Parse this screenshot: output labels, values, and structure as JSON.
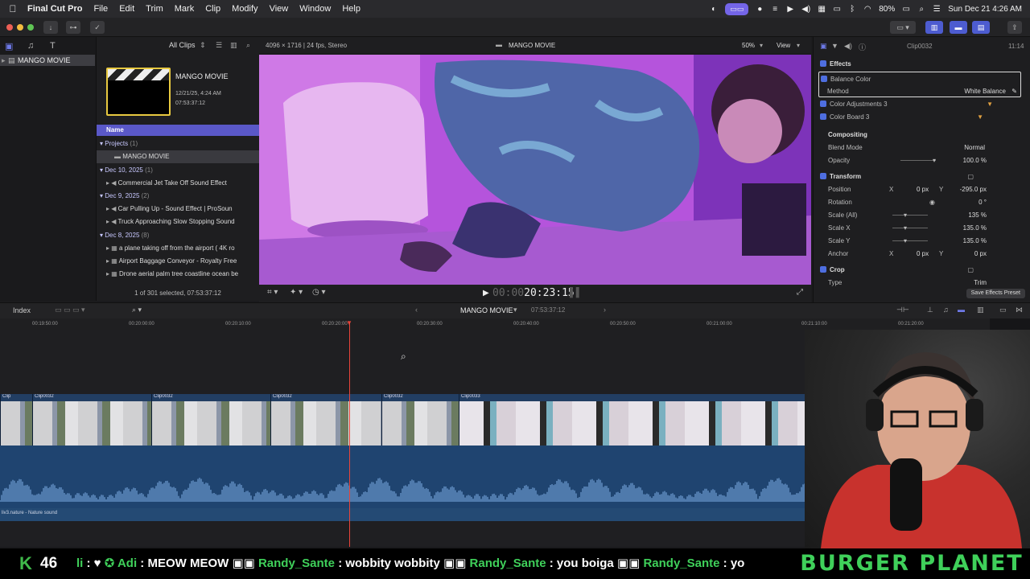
{
  "menubar": {
    "app": "Final Cut Pro",
    "items": [
      "File",
      "Edit",
      "Trim",
      "Mark",
      "Clip",
      "Modify",
      "View",
      "Window",
      "Help"
    ],
    "battery": "80%",
    "datetime": "Sun Dec 21  4:26 AM"
  },
  "library": {
    "name": "MANGO MOVIE"
  },
  "browser": {
    "filter": "All Clips",
    "project_thumb_title": "MANGO MOVIE",
    "project_thumb_date": "12/21/25, 4:24 AM",
    "project_thumb_duration": "07:53:37:12",
    "column_name": "Name",
    "groups": [
      {
        "label": "Projects",
        "count": "(1)",
        "items": [
          "MANGO MOVIE"
        ]
      },
      {
        "label": "Dec 10, 2025",
        "count": "(1)",
        "items": [
          "Commercial Jet Take Off Sound Effect"
        ]
      },
      {
        "label": "Dec 9, 2025",
        "count": "(2)",
        "items": [
          "Car Pulling Up - Sound Effect  |  ProSoun",
          "Truck Approaching Slow Stopping Sound"
        ]
      },
      {
        "label": "Dec 8, 2025",
        "count": "(8)",
        "items": [
          "a plane taking off from the airport ( 4K ro",
          "Airport Baggage Conveyor - Royalty Free",
          "Drone aerial palm tree coastline ocean be"
        ]
      }
    ],
    "selection_info": "1 of 301 selected, 07:53:37:12"
  },
  "viewer": {
    "format": "4096 × 1716 | 24 fps, Stereo",
    "title": "MANGO MOVIE",
    "zoom": "50%",
    "view_menu": "View",
    "timecode_prefix": "00:00",
    "timecode": "20:23:15"
  },
  "inspector": {
    "clip_name": "Clip0032",
    "duration": "11:14",
    "effects_label": "Effects",
    "balance_color": "Balance Color",
    "method_label": "Method",
    "method_value": "White Balance",
    "color_adjustments": "Color Adjustments 3",
    "color_board": "Color Board 3",
    "compositing": "Compositing",
    "blend_mode_label": "Blend Mode",
    "blend_mode_value": "Normal",
    "opacity_label": "Opacity",
    "opacity_value": "100.0 %",
    "opacity_level": 1.0,
    "transform": "Transform",
    "position_label": "Position",
    "position_x": "0 px",
    "position_y": "-295.0 px",
    "rotation_label": "Rotation",
    "rotation_value": "0 °",
    "scale_all_label": "Scale (All)",
    "scale_all_value": "135 %",
    "scale_x_label": "Scale X",
    "scale_x_value": "135.0 %",
    "scale_y_label": "Scale Y",
    "scale_y_value": "135.0 %",
    "anchor_label": "Anchor",
    "anchor_x": "0 px",
    "anchor_y": "0 px",
    "crop": "Crop",
    "type_label": "Type",
    "type_value": "Trim",
    "save_preset": "Save Effects Preset",
    "x": "X",
    "y": "Y"
  },
  "timeline": {
    "index": "Index",
    "project": "MANGO MOVIE",
    "duration": "07:53:37:12",
    "ruler": [
      "00:19:50:00",
      "00:20:00:00",
      "00:20:10:00",
      "00:20:20:00",
      "00:20:30:00",
      "00:20:40:00",
      "00:20:50:00",
      "00:21:00:00",
      "00:21:10:00",
      "00:21:20:00"
    ],
    "clips": [
      "Clip",
      "Clip0032",
      "Clip0032",
      "Clip0032",
      "Clip0032",
      "Clip0033"
    ],
    "audio_clip": "liv3.nature - Nature sound"
  },
  "ticker": {
    "k_label": "K",
    "k_count": "46",
    "message": "li : ♥  ✪ Adi : MEOW  Randy_Sante : wobbity wobbity   Randy_Sante : you boiga   Randy_Sante : yo",
    "segments": [
      {
        "user": "li",
        "text": ": ♥"
      },
      {
        "user": "Adi",
        "text": ": MEOW MEOW"
      },
      {
        "user": "Randy_Sante",
        "text": ": wobbity wobbity"
      },
      {
        "user": "Randy_Sante",
        "text": ": you boiga"
      },
      {
        "user": "Randy_Sante",
        "text": ": yo"
      }
    ],
    "banner": "BURGER PLANET"
  },
  "colors": {
    "accent": "#5a58c8",
    "playhead": "#e8453a",
    "video_clip": "#223e63",
    "audio_clip": "#1f4470",
    "ticker_green": "#3fd05a"
  }
}
